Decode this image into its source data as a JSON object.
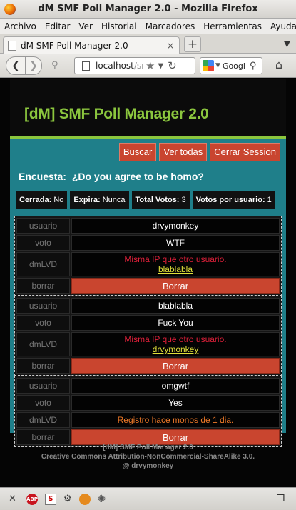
{
  "window": {
    "title": "dM SMF Poll Manager 2.0 - Mozilla Firefox"
  },
  "menu": [
    "Archivo",
    "Editar",
    "Ver",
    "Historial",
    "Marcadores",
    "Herramientas",
    "Ayuda"
  ],
  "tab": {
    "label": "dM SMF Poll Manager 2.0",
    "close": "×"
  },
  "nav": {
    "url_host": "localhost",
    "url_path": "/sm",
    "search_text": "Googl"
  },
  "page": {
    "logo": "[dM] SMF Poll Manager 2.0",
    "buttons": {
      "search": "Buscar",
      "view_all": "Ver todas",
      "logout": "Cerrar Session"
    },
    "survey_label": "Encuesta:",
    "survey_question": "¿Do you agree to be homo?",
    "stats": {
      "closed_label": "Cerrada:",
      "closed_value": "No",
      "expires_label": "Expira:",
      "expires_value": "Nunca",
      "total_label": "Total Votos:",
      "total_value": "3",
      "per_user_label": "Votos por usuario:",
      "per_user_value": "1"
    },
    "labels": {
      "user": "usuario",
      "vote": "voto",
      "dmlvd": "dmLVD",
      "delete": "borrar"
    },
    "delete_button": "Borrar",
    "votes": [
      {
        "user": "drvymonkey",
        "vote": "WTF",
        "note": "Misma IP que otro usuario.",
        "link": "blablabla"
      },
      {
        "user": "blablabla",
        "vote": "Fuck You",
        "note": "Misma IP que otro usuario.",
        "link": "drvymonkey"
      },
      {
        "user": "omgwtf",
        "vote": "Yes",
        "note": "Registro hace monos de 1 dia."
      }
    ],
    "footer": {
      "line1": "[dM] SMF Poll Manager 2.0",
      "line2": "Creative Commons Attribution-NonCommercial-ShareAlike 3.0.",
      "line3": "@ drvymonkey"
    }
  }
}
